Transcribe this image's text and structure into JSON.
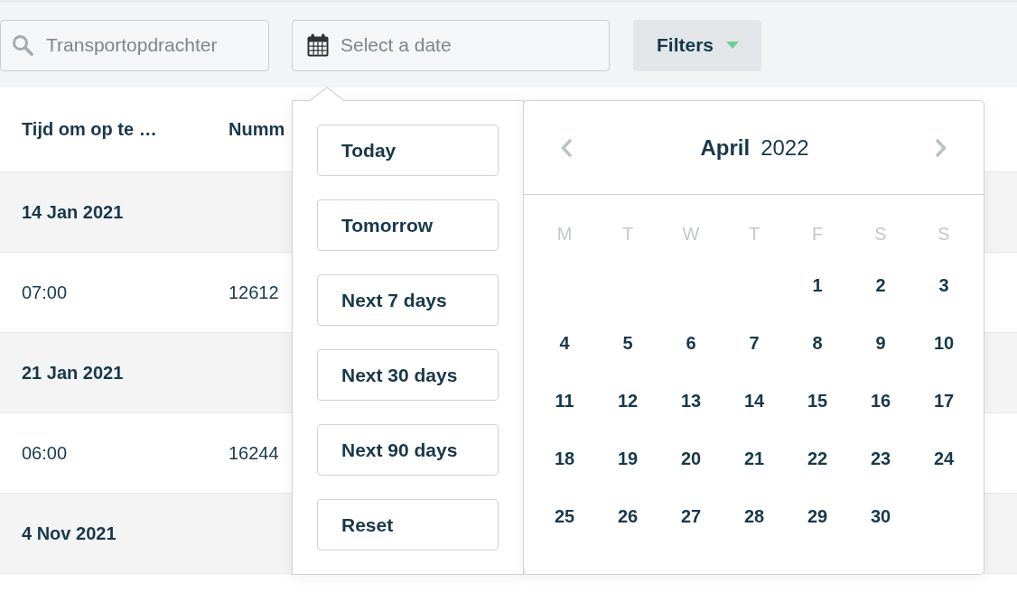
{
  "toolbar": {
    "search": {
      "placeholder": "Transportopdrachter"
    },
    "date_field": {
      "placeholder": "Select a date"
    },
    "filters_button": {
      "label": "Filters"
    }
  },
  "table": {
    "columns": [
      "Tijd om op te …",
      "Numm"
    ],
    "rows": [
      {
        "kind": "group",
        "cells": [
          "14 Jan 2021"
        ]
      },
      {
        "kind": "entry",
        "cells": [
          "07:00",
          "12612"
        ]
      },
      {
        "kind": "group",
        "cells": [
          "21 Jan 2021"
        ]
      },
      {
        "kind": "entry",
        "cells": [
          "06:00",
          "16244"
        ]
      },
      {
        "kind": "group",
        "cells": [
          "4 Nov 2021"
        ]
      }
    ]
  },
  "date_picker": {
    "presets": [
      "Today",
      "Tomorrow",
      "Next 7 days",
      "Next 30 days",
      "Next 90 days",
      "Reset"
    ],
    "calendar": {
      "month": "April",
      "year": "2022",
      "weekdays": [
        "M",
        "T",
        "W",
        "T",
        "F",
        "S",
        "S"
      ],
      "weeks": [
        [
          "1",
          "2",
          "3"
        ],
        [
          "4",
          "5",
          "6",
          "7",
          "8",
          "9",
          "10"
        ],
        [
          "11",
          "12",
          "13",
          "14",
          "15",
          "16",
          "17"
        ],
        [
          "18",
          "19",
          "20",
          "21",
          "22",
          "23",
          "24"
        ],
        [
          "25",
          "26",
          "27",
          "28",
          "29",
          "30"
        ]
      ]
    }
  }
}
